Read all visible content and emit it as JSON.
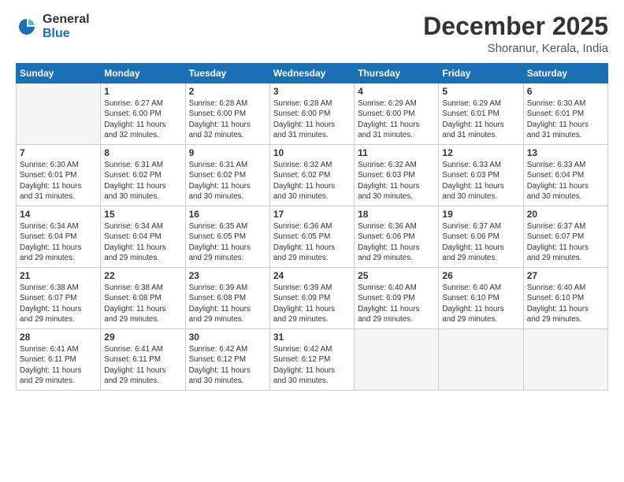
{
  "logo": {
    "general": "General",
    "blue": "Blue"
  },
  "title": "December 2025",
  "location": "Shoranur, Kerala, India",
  "days_header": [
    "Sunday",
    "Monday",
    "Tuesday",
    "Wednesday",
    "Thursday",
    "Friday",
    "Saturday"
  ],
  "weeks": [
    [
      {
        "day": "",
        "content": ""
      },
      {
        "day": "1",
        "content": "Sunrise: 6:27 AM\nSunset: 6:00 PM\nDaylight: 11 hours\nand 32 minutes."
      },
      {
        "day": "2",
        "content": "Sunrise: 6:28 AM\nSunset: 6:00 PM\nDaylight: 11 hours\nand 32 minutes."
      },
      {
        "day": "3",
        "content": "Sunrise: 6:28 AM\nSunset: 6:00 PM\nDaylight: 11 hours\nand 31 minutes."
      },
      {
        "day": "4",
        "content": "Sunrise: 6:29 AM\nSunset: 6:00 PM\nDaylight: 11 hours\nand 31 minutes."
      },
      {
        "day": "5",
        "content": "Sunrise: 6:29 AM\nSunset: 6:01 PM\nDaylight: 11 hours\nand 31 minutes."
      },
      {
        "day": "6",
        "content": "Sunrise: 6:30 AM\nSunset: 6:01 PM\nDaylight: 11 hours\nand 31 minutes."
      }
    ],
    [
      {
        "day": "7",
        "content": "Sunrise: 6:30 AM\nSunset: 6:01 PM\nDaylight: 11 hours\nand 31 minutes."
      },
      {
        "day": "8",
        "content": "Sunrise: 6:31 AM\nSunset: 6:02 PM\nDaylight: 11 hours\nand 30 minutes."
      },
      {
        "day": "9",
        "content": "Sunrise: 6:31 AM\nSunset: 6:02 PM\nDaylight: 11 hours\nand 30 minutes."
      },
      {
        "day": "10",
        "content": "Sunrise: 6:32 AM\nSunset: 6:02 PM\nDaylight: 11 hours\nand 30 minutes."
      },
      {
        "day": "11",
        "content": "Sunrise: 6:32 AM\nSunset: 6:03 PM\nDaylight: 11 hours\nand 30 minutes."
      },
      {
        "day": "12",
        "content": "Sunrise: 6:33 AM\nSunset: 6:03 PM\nDaylight: 11 hours\nand 30 minutes."
      },
      {
        "day": "13",
        "content": "Sunrise: 6:33 AM\nSunset: 6:04 PM\nDaylight: 11 hours\nand 30 minutes."
      }
    ],
    [
      {
        "day": "14",
        "content": "Sunrise: 6:34 AM\nSunset: 6:04 PM\nDaylight: 11 hours\nand 29 minutes."
      },
      {
        "day": "15",
        "content": "Sunrise: 6:34 AM\nSunset: 6:04 PM\nDaylight: 11 hours\nand 29 minutes."
      },
      {
        "day": "16",
        "content": "Sunrise: 6:35 AM\nSunset: 6:05 PM\nDaylight: 11 hours\nand 29 minutes."
      },
      {
        "day": "17",
        "content": "Sunrise: 6:36 AM\nSunset: 6:05 PM\nDaylight: 11 hours\nand 29 minutes."
      },
      {
        "day": "18",
        "content": "Sunrise: 6:36 AM\nSunset: 6:06 PM\nDaylight: 11 hours\nand 29 minutes."
      },
      {
        "day": "19",
        "content": "Sunrise: 6:37 AM\nSunset: 6:06 PM\nDaylight: 11 hours\nand 29 minutes."
      },
      {
        "day": "20",
        "content": "Sunrise: 6:37 AM\nSunset: 6:07 PM\nDaylight: 11 hours\nand 29 minutes."
      }
    ],
    [
      {
        "day": "21",
        "content": "Sunrise: 6:38 AM\nSunset: 6:07 PM\nDaylight: 11 hours\nand 29 minutes."
      },
      {
        "day": "22",
        "content": "Sunrise: 6:38 AM\nSunset: 6:08 PM\nDaylight: 11 hours\nand 29 minutes."
      },
      {
        "day": "23",
        "content": "Sunrise: 6:39 AM\nSunset: 6:08 PM\nDaylight: 11 hours\nand 29 minutes."
      },
      {
        "day": "24",
        "content": "Sunrise: 6:39 AM\nSunset: 6:09 PM\nDaylight: 11 hours\nand 29 minutes."
      },
      {
        "day": "25",
        "content": "Sunrise: 6:40 AM\nSunset: 6:09 PM\nDaylight: 11 hours\nand 29 minutes."
      },
      {
        "day": "26",
        "content": "Sunrise: 6:40 AM\nSunset: 6:10 PM\nDaylight: 11 hours\nand 29 minutes."
      },
      {
        "day": "27",
        "content": "Sunrise: 6:40 AM\nSunset: 6:10 PM\nDaylight: 11 hours\nand 29 minutes."
      }
    ],
    [
      {
        "day": "28",
        "content": "Sunrise: 6:41 AM\nSunset: 6:11 PM\nDaylight: 11 hours\nand 29 minutes."
      },
      {
        "day": "29",
        "content": "Sunrise: 6:41 AM\nSunset: 6:11 PM\nDaylight: 11 hours\nand 29 minutes."
      },
      {
        "day": "30",
        "content": "Sunrise: 6:42 AM\nSunset: 6:12 PM\nDaylight: 11 hours\nand 30 minutes."
      },
      {
        "day": "31",
        "content": "Sunrise: 6:42 AM\nSunset: 6:12 PM\nDaylight: 11 hours\nand 30 minutes."
      },
      {
        "day": "",
        "content": ""
      },
      {
        "day": "",
        "content": ""
      },
      {
        "day": "",
        "content": ""
      }
    ]
  ]
}
